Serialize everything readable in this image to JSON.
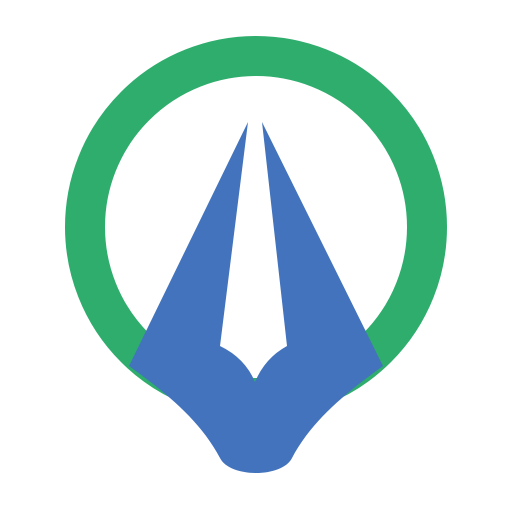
{
  "logo": {
    "icon": "pen-nib-location-pin-icon",
    "colors": {
      "ring": "#2EAD6D",
      "nib": "#4273BC",
      "background": "#FFFFFF"
    }
  }
}
